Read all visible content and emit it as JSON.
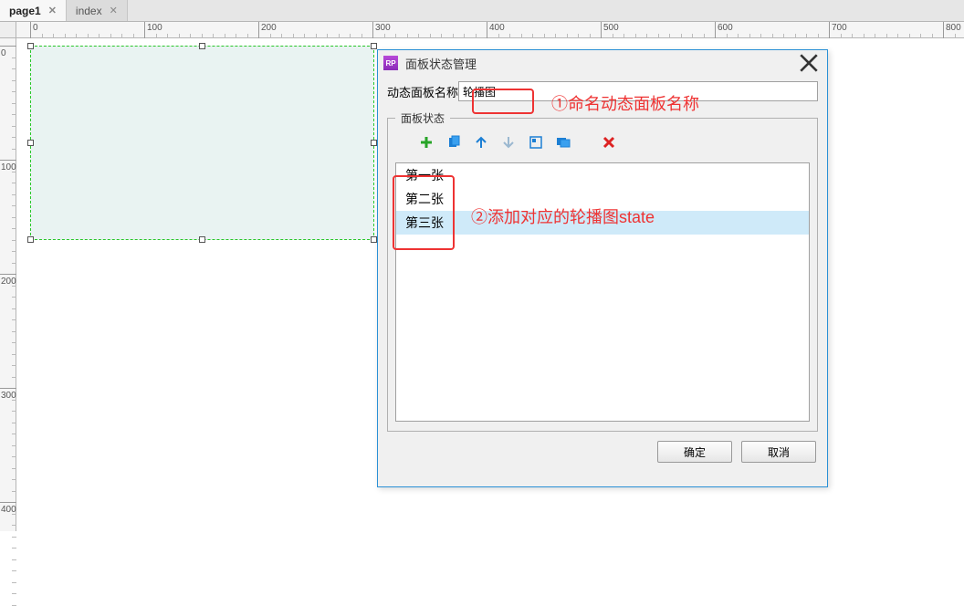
{
  "tabs": [
    {
      "label": "page1",
      "active": true
    },
    {
      "label": "index",
      "active": false
    }
  ],
  "hruler_labels": [
    "0",
    "100",
    "200",
    "300",
    "400",
    "500",
    "600",
    "700",
    "800"
  ],
  "vruler_labels": [
    "0",
    "100",
    "200",
    "300",
    "400"
  ],
  "dialog": {
    "title": "面板状态管理",
    "name_label": "动态面板名称",
    "name_value": "轮播图",
    "states_legend": "面板状态",
    "states": [
      "第一张",
      "第二张",
      "第三张"
    ],
    "selected_index": 2,
    "ok": "确定",
    "cancel": "取消"
  },
  "annotations": {
    "a1": "①命名动态面板名称",
    "a2": "②添加对应的轮播图state"
  }
}
